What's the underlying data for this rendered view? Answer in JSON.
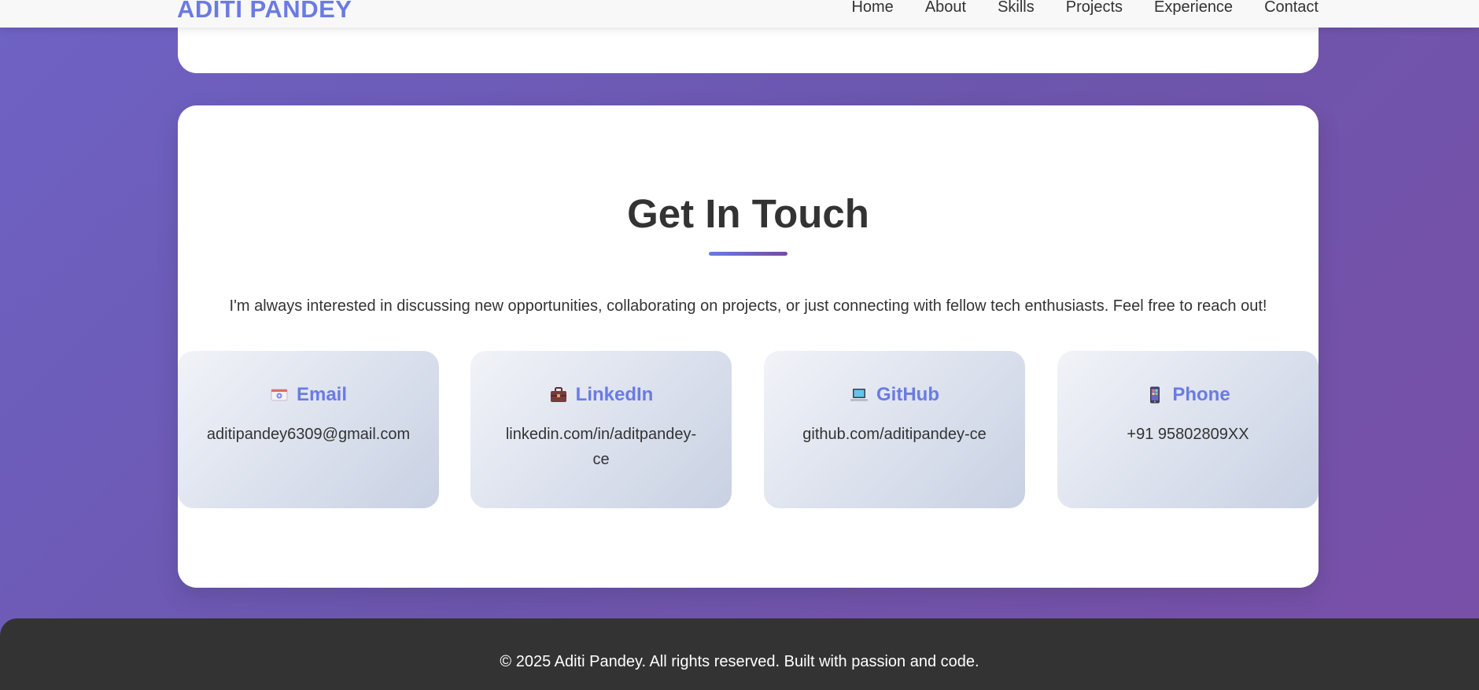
{
  "nav": {
    "brand": "ADITI PANDEY",
    "links": [
      "Home",
      "About",
      "Skills",
      "Projects",
      "Experience",
      "Contact"
    ]
  },
  "contact": {
    "title": "Get In Touch",
    "intro": "I'm always interested in discussing new opportunities, collaborating on projects, or just connecting with fellow tech enthusiasts. Feel free to reach out!",
    "methods": [
      {
        "icon": "email-icon",
        "label": "Email",
        "value": "aditipandey6309@gmail.com"
      },
      {
        "icon": "briefcase-icon",
        "label": "LinkedIn",
        "value": "linkedin.com/in/aditpandey-ce"
      },
      {
        "icon": "laptop-icon",
        "label": "GitHub",
        "value": "github.com/aditipandey-ce"
      },
      {
        "icon": "phone-icon",
        "label": "Phone",
        "value": "+91 95802809XX"
      }
    ]
  },
  "footer": {
    "text": "© 2025 Aditi Pandey. All rights reserved. Built with passion and code."
  },
  "colors": {
    "accent": "#6a7be3",
    "gradient_end": "#764ba2",
    "footer_bg": "#333333"
  }
}
